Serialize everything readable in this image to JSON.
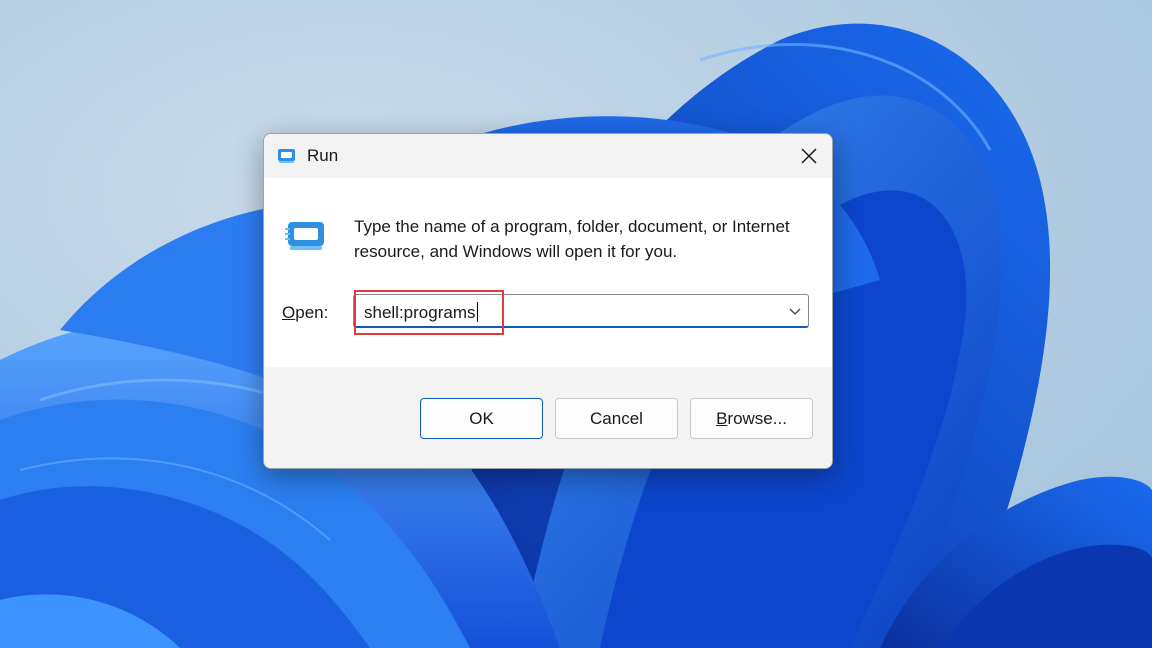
{
  "dialog": {
    "title": "Run",
    "description": "Type the name of a program, folder, document, or Internet resource, and Windows will open it for you.",
    "open_label_first": "O",
    "open_label_rest": "pen:",
    "open_value": "shell:programs"
  },
  "buttons": {
    "ok": "OK",
    "cancel": "Cancel",
    "browse_first": "B",
    "browse_rest": "rowse..."
  },
  "icons": {
    "title": "run-icon",
    "main": "run-icon",
    "close": "close-icon",
    "dropdown": "chevron-down-icon"
  },
  "colors": {
    "accent": "#0f5cbb",
    "highlight": "#e23a3a",
    "wallpaper_blue": "#1c5fe0",
    "wallpaper_bg": "#b6cfe3"
  }
}
